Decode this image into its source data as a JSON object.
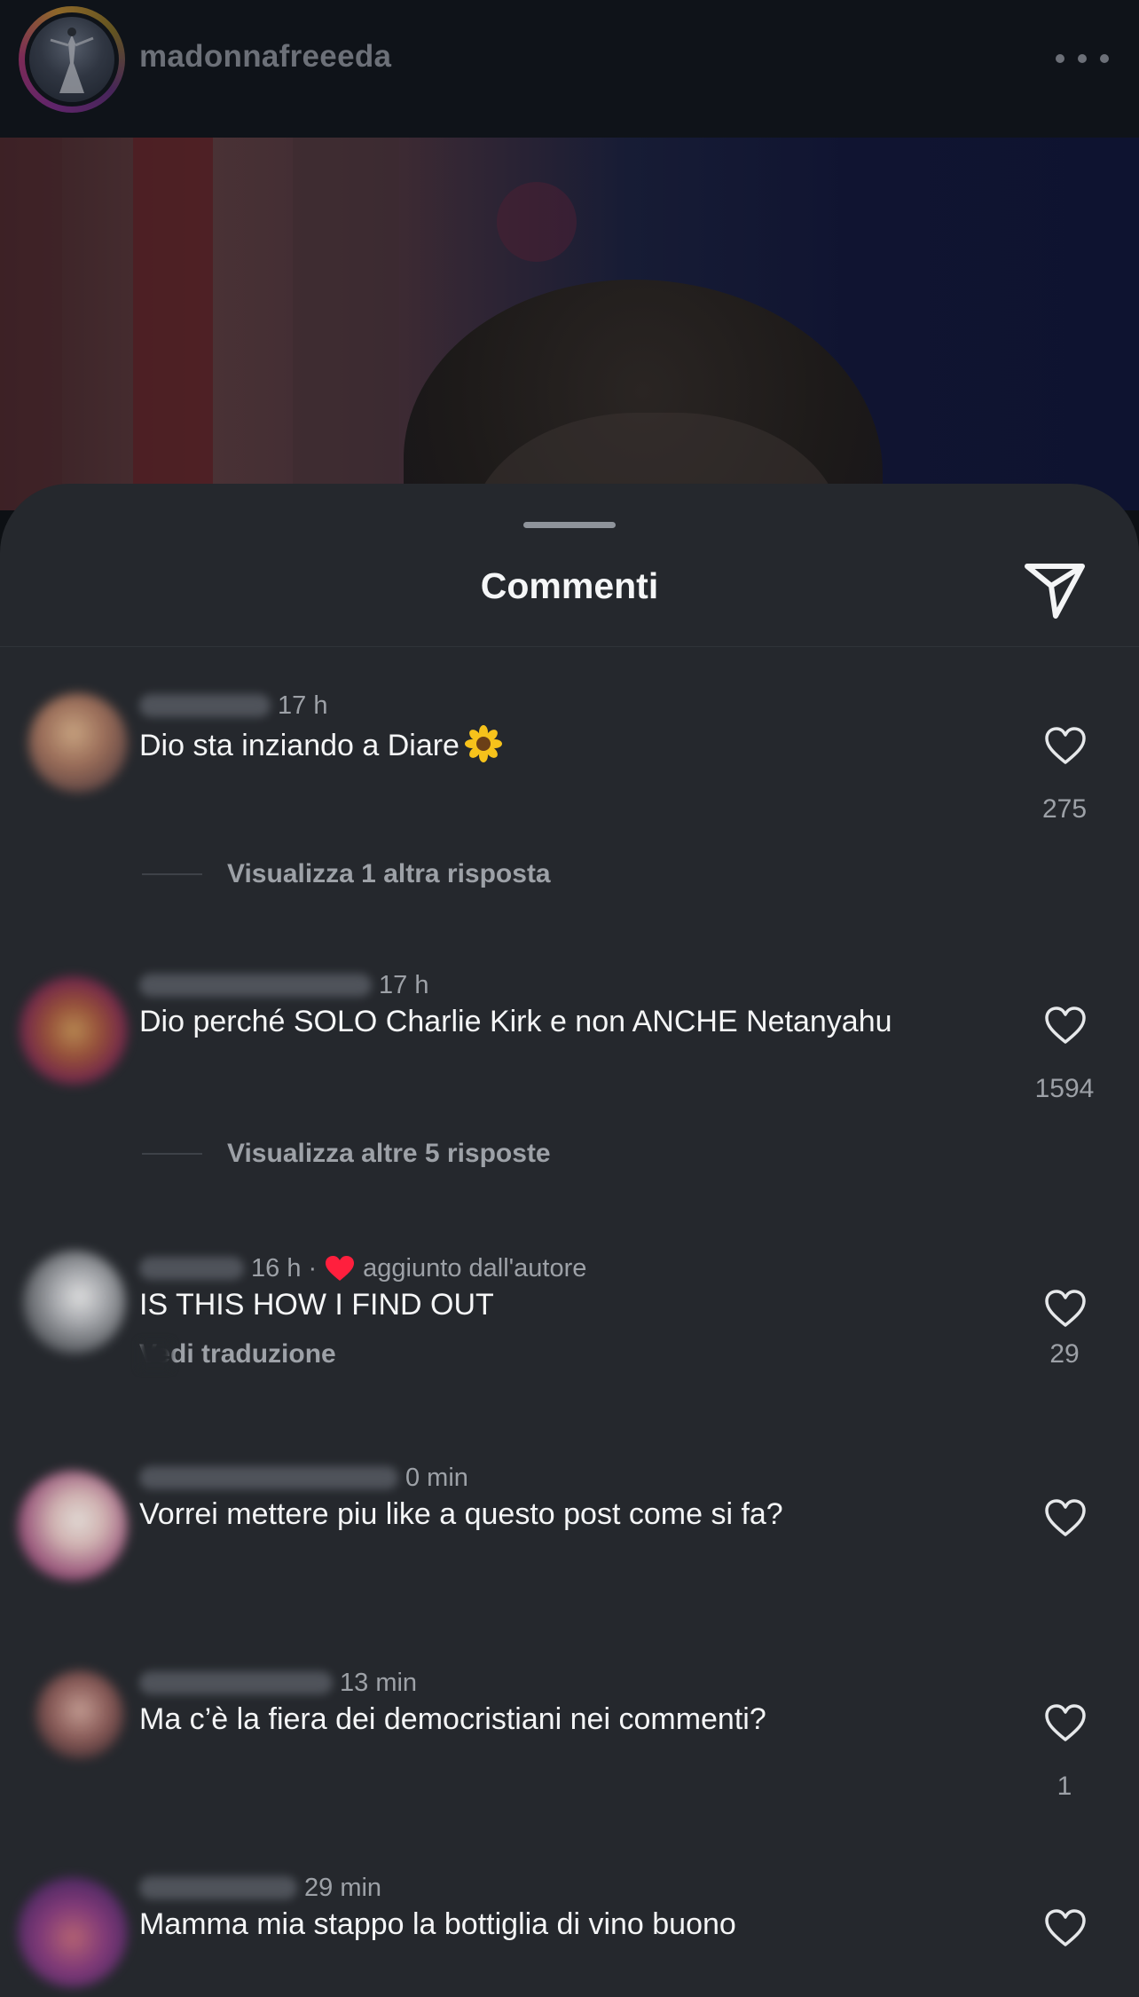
{
  "header": {
    "username": "madonnafreeeda",
    "more_icon": "more-horizontal-icon"
  },
  "sheet": {
    "title": "Commenti",
    "share_icon": "send-paper-plane-icon"
  },
  "comments": [
    {
      "time": "17 h",
      "text": "Dio sta inziando a Diare",
      "emoji": "sunflower",
      "likes": "275",
      "replies_label": "Visualizza 1 altra risposta"
    },
    {
      "time": "17 h",
      "text": "Dio perché SOLO Charlie Kirk e non ANCHE Netanyahu",
      "likes": "1594",
      "replies_label": "Visualizza altre 5 risposte"
    },
    {
      "time": "16 h ·",
      "author_badge": "aggiunto dall'autore",
      "text": "IS THIS HOW I FIND OUT",
      "translation_label": "Vedi traduzione",
      "likes": "29"
    },
    {
      "time": "0 min",
      "text": "Vorrei mettere piu like a questo post come si fa?",
      "likes": ""
    },
    {
      "time": "13 min",
      "text": "Ma c’è la fiera dei democristiani nei commenti?",
      "likes": "1"
    },
    {
      "time": "29 min",
      "text": "Mamma mia stappo la bottiglia di vino buono",
      "likes": ""
    }
  ],
  "colors": {
    "sheet_bg": "#25282d",
    "author_heart": "#ff1f3d",
    "muted_text": "#9da1a7"
  }
}
